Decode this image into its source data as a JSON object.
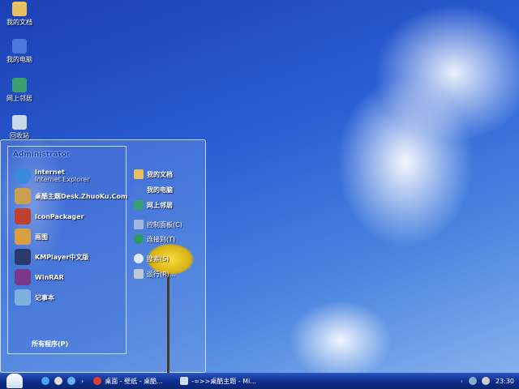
{
  "desktop": {
    "icons": [
      {
        "label": "我的文档",
        "icon": "folder-icon",
        "color": "#e8c060"
      },
      {
        "label": "我的电脑",
        "icon": "computer-icon",
        "color": "#4a7ad8"
      },
      {
        "label": "网上邻居",
        "icon": "network-icon",
        "color": "#3aa070"
      },
      {
        "label": "回收站",
        "icon": "recycle-bin-icon",
        "color": "#c8d8e8"
      }
    ]
  },
  "start_menu": {
    "user": "Administrator",
    "programs": [
      {
        "label": "Internet",
        "sub": "Internet Explorer",
        "icon": "internet-explorer-icon",
        "color": "#3a8ae0"
      },
      {
        "label": "桌酷主题Desk.ZhuoKu.Com",
        "icon": "zhuoku-icon",
        "color": "#c8a050"
      },
      {
        "label": "IconPackager",
        "icon": "iconpackager-icon",
        "color": "#c04030"
      },
      {
        "label": "画图",
        "icon": "paint-icon",
        "color": "#d8a040"
      },
      {
        "label": "KMPlayer中文版",
        "icon": "kmplayer-icon",
        "color": "#2a3a6a"
      },
      {
        "label": "WinRAR",
        "icon": "winrar-icon",
        "color": "#7a3a8a"
      },
      {
        "label": "记事本",
        "icon": "notepad-icon",
        "color": "#80b0e0"
      }
    ],
    "all_programs": "所有程序(P)",
    "right": [
      {
        "label": "我的文档",
        "icon": "folder-icon",
        "color": "#e8c060"
      },
      {
        "label": "我的电脑",
        "icon": "computer-icon",
        "color": "#4a7ad8"
      },
      {
        "label": "网上邻居",
        "icon": "network-icon",
        "color": "#3aa070"
      },
      {
        "label": "控制面板(C)",
        "icon": "control-panel-icon",
        "color": "#a0b8e0"
      },
      {
        "label": "连接到(T)",
        "icon": "connect-icon",
        "color": "#2a9a60"
      },
      {
        "label": "搜索(S)",
        "icon": "search-icon",
        "color": "#e0e8f8"
      },
      {
        "label": "运行(R)...",
        "icon": "run-icon",
        "color": "#c0c8d8"
      }
    ]
  },
  "taskbar": {
    "tasks": [
      {
        "label": "桌面 - 壁纸 - 桌酷...",
        "icon": "chrome-icon"
      },
      {
        "label": "-=>>桌酷主题 - Mi...",
        "icon": "word-icon"
      }
    ],
    "clock": "23:30"
  }
}
